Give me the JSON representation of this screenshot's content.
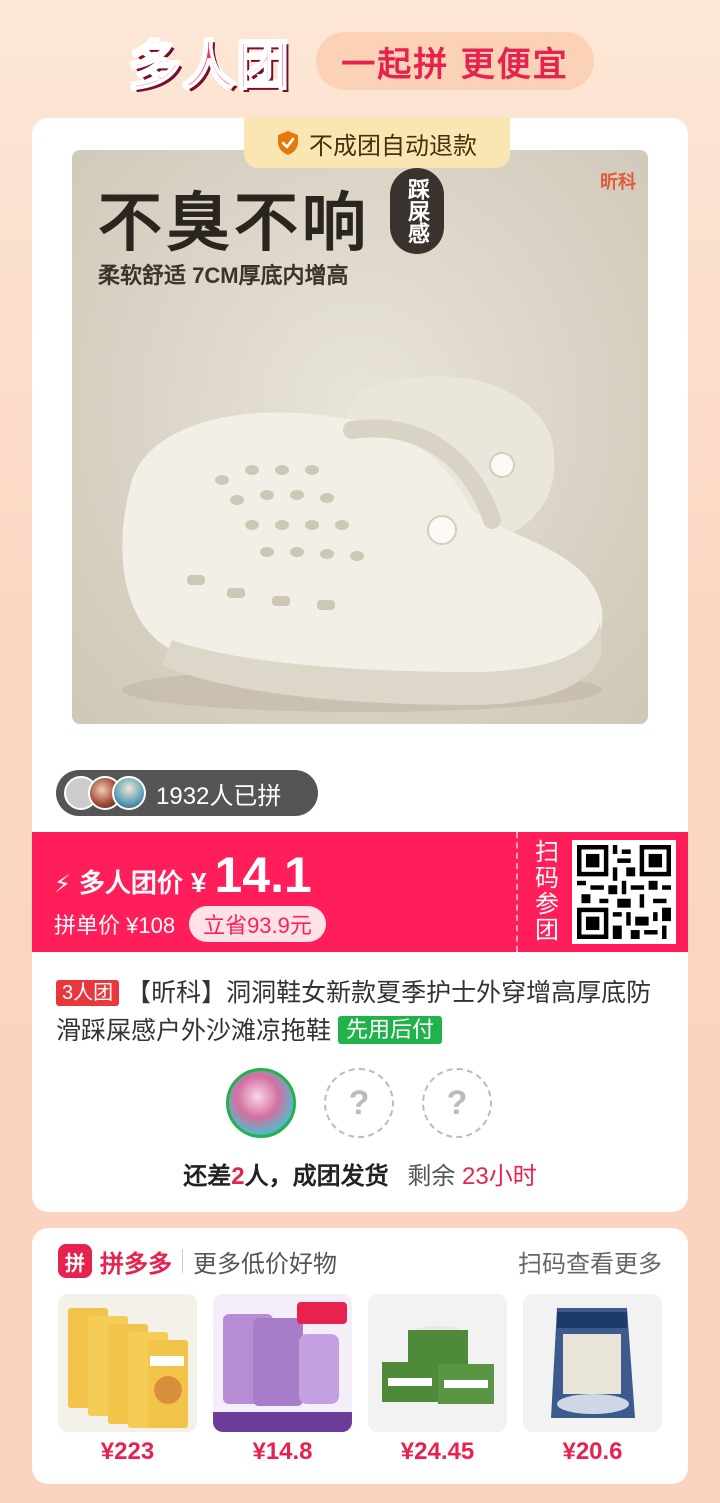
{
  "header": {
    "brand": "多人团",
    "slogan": "一起拼 更便宜"
  },
  "product": {
    "refund_badge": "不成团自动退款",
    "image_headline": "不臭不响",
    "image_tag": "踩屎感",
    "image_subline": "柔软舒适 7CM厚底内增高",
    "image_brand": "昕科",
    "joined_text": "1932人已拼",
    "group_label": "多人团价",
    "currency": "¥",
    "group_price": "14.1",
    "single_price": "拼单价 ¥108",
    "save": "立省93.9元",
    "qr_label": "扫码参团",
    "group_tag": "3人团",
    "title": "【昕科】洞洞鞋女新款夏季护士外穿增高厚底防滑踩屎感户外沙滩凉拖鞋",
    "pay_tag": "先用后付",
    "status_prefix": "还差",
    "status_count": "2",
    "status_suffix": "人，成团发货",
    "remaining_label": "剩余",
    "remaining_time": "23小时",
    "empty_slot": "?"
  },
  "more": {
    "logo_char": "拼",
    "logo_name": "拼多多",
    "subtitle": "更多低价好物",
    "right_text": "扫码查看更多",
    "goods": [
      {
        "price": "¥223"
      },
      {
        "price": "¥14.8"
      },
      {
        "price": "¥24.45"
      },
      {
        "price": "¥20.6"
      }
    ]
  },
  "colors": {
    "accent": "#ff1e5a",
    "green": "#22b24c"
  }
}
